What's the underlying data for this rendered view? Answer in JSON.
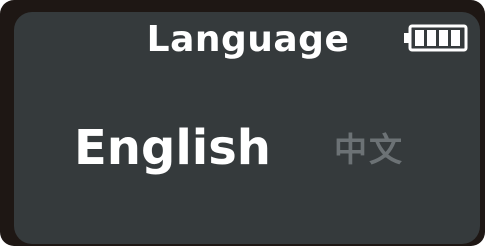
{
  "header": {
    "title": "Language",
    "battery_icon": "battery-full-icon",
    "battery_level": 1.0
  },
  "options": [
    {
      "label": "English",
      "selected": true
    },
    {
      "label": "中文",
      "selected": false
    }
  ],
  "colors": {
    "bezel": "#1e1714",
    "screen": "#353a3c",
    "selected_text": "#ffffff",
    "unselected_text": "#6c7275"
  }
}
